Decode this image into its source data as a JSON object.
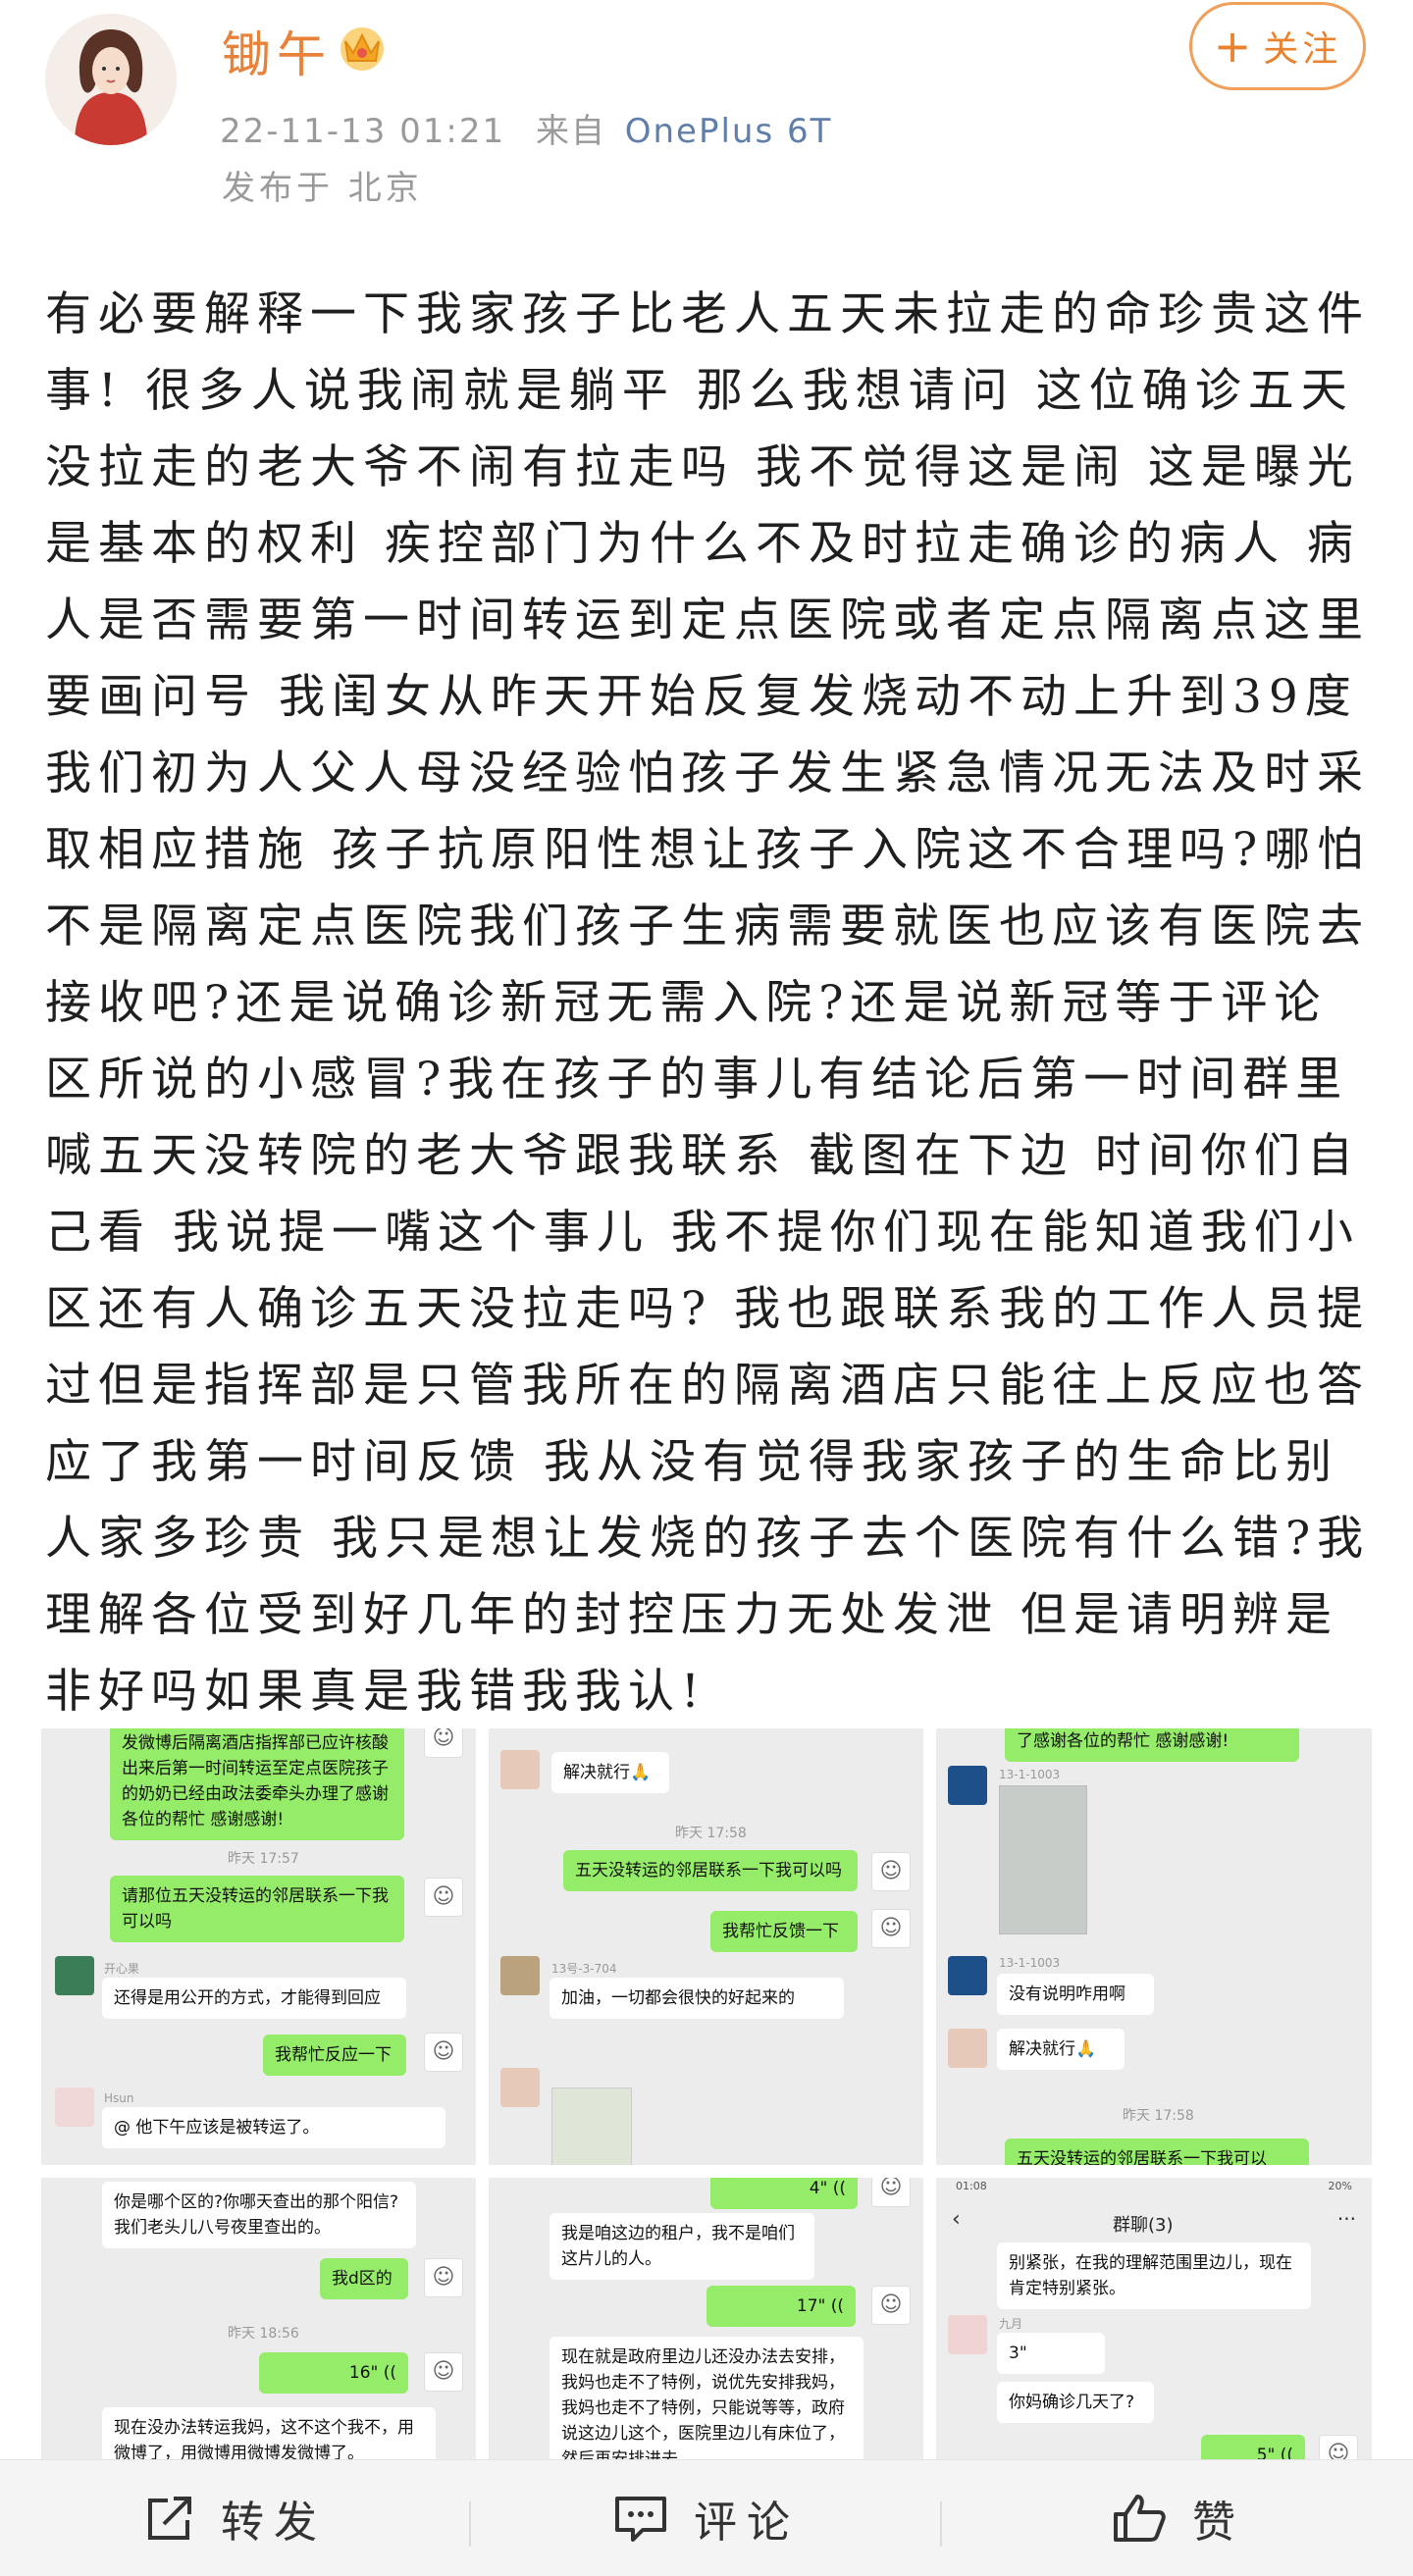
{
  "header": {
    "username": "锄午",
    "timestamp": "22-11-13 01:21",
    "source_prefix": "来自",
    "device": "OnePlus 6T",
    "location": "发布于 北京",
    "follow_label": "关注"
  },
  "post": {
    "text": "有必要解释一下我家孩子比老人五天未拉走的命珍贵这件事!  很多人说我闹就是躺平 那么我想请问 这位确诊五天没拉走的老大爷不闹有拉走吗 我不觉得这是闹 这是曝光是基本的权利 疾控部门为什么不及时拉走确诊的病人 病人是否需要第一时间转运到定点医院或者定点隔离点这里要画问号 我闺女从昨天开始反复发烧动不动上升到39度我们初为人父人母没经验怕孩子发生紧急情况无法及时采取相应措施 孩子抗原阳性想让孩子入院这不合理吗?哪怕不是隔离定点医院我们孩子生病需要就医也应该有医院去接收吧?还是说确诊新冠无需入院?还是说新冠等于评论区所说的小感冒?我在孩子的事儿有结论后第一时间群里喊五天没转院的老大爷跟我联系 截图在下边 时间你们自己看 我说提一嘴这个事儿 我不提你们现在能知道我们小区还有人确诊五天没拉走吗?  我也跟联系我的工作人员提过但是指挥部是只管我所在的隔离酒店只能往上反应也答应了我第一时间反馈 我从没有觉得我家孩子的生命比别人家多珍贵 我只是想让发烧的孩子去个医院有什么错?我理解各位受到好几年的封控压力无处发泄 但是请明辨是非好吗如果真是我错我我认!"
  },
  "screenshots": {
    "s1": {
      "b1": "发微博后隔离酒店指挥部已应许核酸出来后第一时间转运至定点医院孩子的奶奶已经由政法委牵头办理了感谢各位的帮忙 感谢感谢!",
      "t1": "昨天 17:57",
      "b2": "请那位五天没转运的邻居联系一下我可以吗",
      "n1": "开心果",
      "b3": "还得是用公开的方式，才能得到回应",
      "b4": "我帮忙反应一下",
      "n2": "Hsun",
      "b5": "@         他下午应该是被转运了。"
    },
    "s2": {
      "b1": "解决就行🙏",
      "t1": "昨天 17:58",
      "b2": "五天没转运的邻居联系一下我可以吗",
      "b3": "我帮忙反馈一下",
      "n1": "13号-3-704",
      "b4": "加油，一切都会很快的好起来的"
    },
    "s3": {
      "b1": "了感谢各位的帮忙 感谢感谢!",
      "n1": "13-1-1003",
      "n2": "13-1-1003",
      "b2": "没有说明咋用啊",
      "b3": "解决就行🙏",
      "t1": "昨天 17:58",
      "b4": "五天没转运的邻居联系一下我可以"
    },
    "s4": {
      "b1": "你是哪个区的?你哪天查出的那个阳信?我们老头儿八号夜里查出的。",
      "b2": "我d区的",
      "t1": "昨天 18:56",
      "b3": "16\" ((",
      "b4": "现在没办法转运我妈，这不这个我不，用微博了，用微博用微博发微博了。"
    },
    "s5": {
      "b1": "4\" ((",
      "b2": "我是咱这边的租户，我不是咱们这片儿的人。",
      "b3": "17\" ((",
      "b4": "现在就是政府里边儿还没办法去安排，我妈也走不了特例，说优先安排我妈，我妈也走不了特例，只能说等等，政府说这边儿这个，医院里边儿有床位了，然后再安排进去。"
    },
    "s6": {
      "status_time": "01:08",
      "status_right": "20%",
      "title": "群聊(3)",
      "b1": "别紧张，在我的理解范围里边儿，现在肯定特别紧张。",
      "n1": "九月",
      "b2": "3\"",
      "b3": "你妈确诊几天了?",
      "b4": "5\" (("
    }
  },
  "actions": {
    "repost": "转发",
    "comment": "评论",
    "like": "赞"
  },
  "colors": {
    "username": "#e8823a",
    "wechat_green": "#95ec69",
    "device_link": "#5f7faa"
  }
}
